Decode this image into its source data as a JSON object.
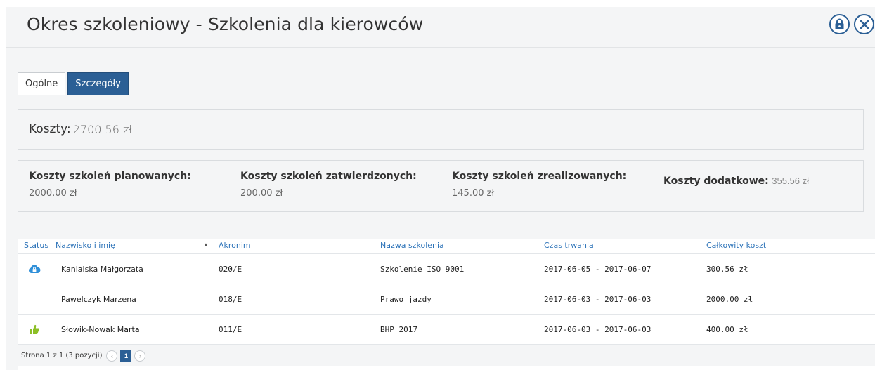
{
  "header": {
    "title": "Okres szkoleniowy - Szkolenia dla kierowców"
  },
  "tabs": [
    {
      "label": "Ogólne",
      "active": false
    },
    {
      "label": "Szczegóły",
      "active": true
    }
  ],
  "costs": {
    "label": "Koszty:",
    "value": "2700.56 zł"
  },
  "summary": {
    "planned_label": "Koszty szkoleń planowanych:",
    "planned_value": "2000.00 zł",
    "approved_label": "Koszty szkoleń zatwierdzonych:",
    "approved_value": "200.00 zł",
    "realized_label": "Koszty szkoleń zrealizowanych:",
    "realized_value": "145.00 zł",
    "additional_label": "Koszty dodatkowe:",
    "additional_value": "355.56 zł"
  },
  "table": {
    "columns": [
      "Status",
      "Nazwisko i imię",
      "Akronim",
      "Nazwa szkolenia",
      "Czas trwania",
      "Całkowity koszt"
    ],
    "rows": [
      {
        "status_icon": "cloud-lock-icon",
        "name": "Kanialska Małgorzata",
        "acronym": "020/E",
        "training": "Szkolenie ISO 9001",
        "duration": "2017-06-05 - 2017-06-07",
        "cost": "300.56 zł"
      },
      {
        "status_icon": "",
        "name": "Pawelczyk Marzena",
        "acronym": "018/E",
        "training": "Prawo jazdy",
        "duration": "2017-06-03 - 2017-06-03",
        "cost": "2000.00 zł"
      },
      {
        "status_icon": "thumb-up-icon",
        "name": "Słowik-Nowak Marta",
        "acronym": "011/E",
        "training": "BHP 2017",
        "duration": "2017-06-03 - 2017-06-03",
        "cost": "400.00 zł"
      }
    ]
  },
  "pager": {
    "text": "Strona 1 z 1 (3 pozycji)",
    "prev": "‹",
    "current": "1",
    "next": "›"
  },
  "colors": {
    "accent": "#2b5f95",
    "link": "#2b72b8",
    "status_cloud": "#2f8fd8",
    "status_thumb": "#8cbf26"
  }
}
